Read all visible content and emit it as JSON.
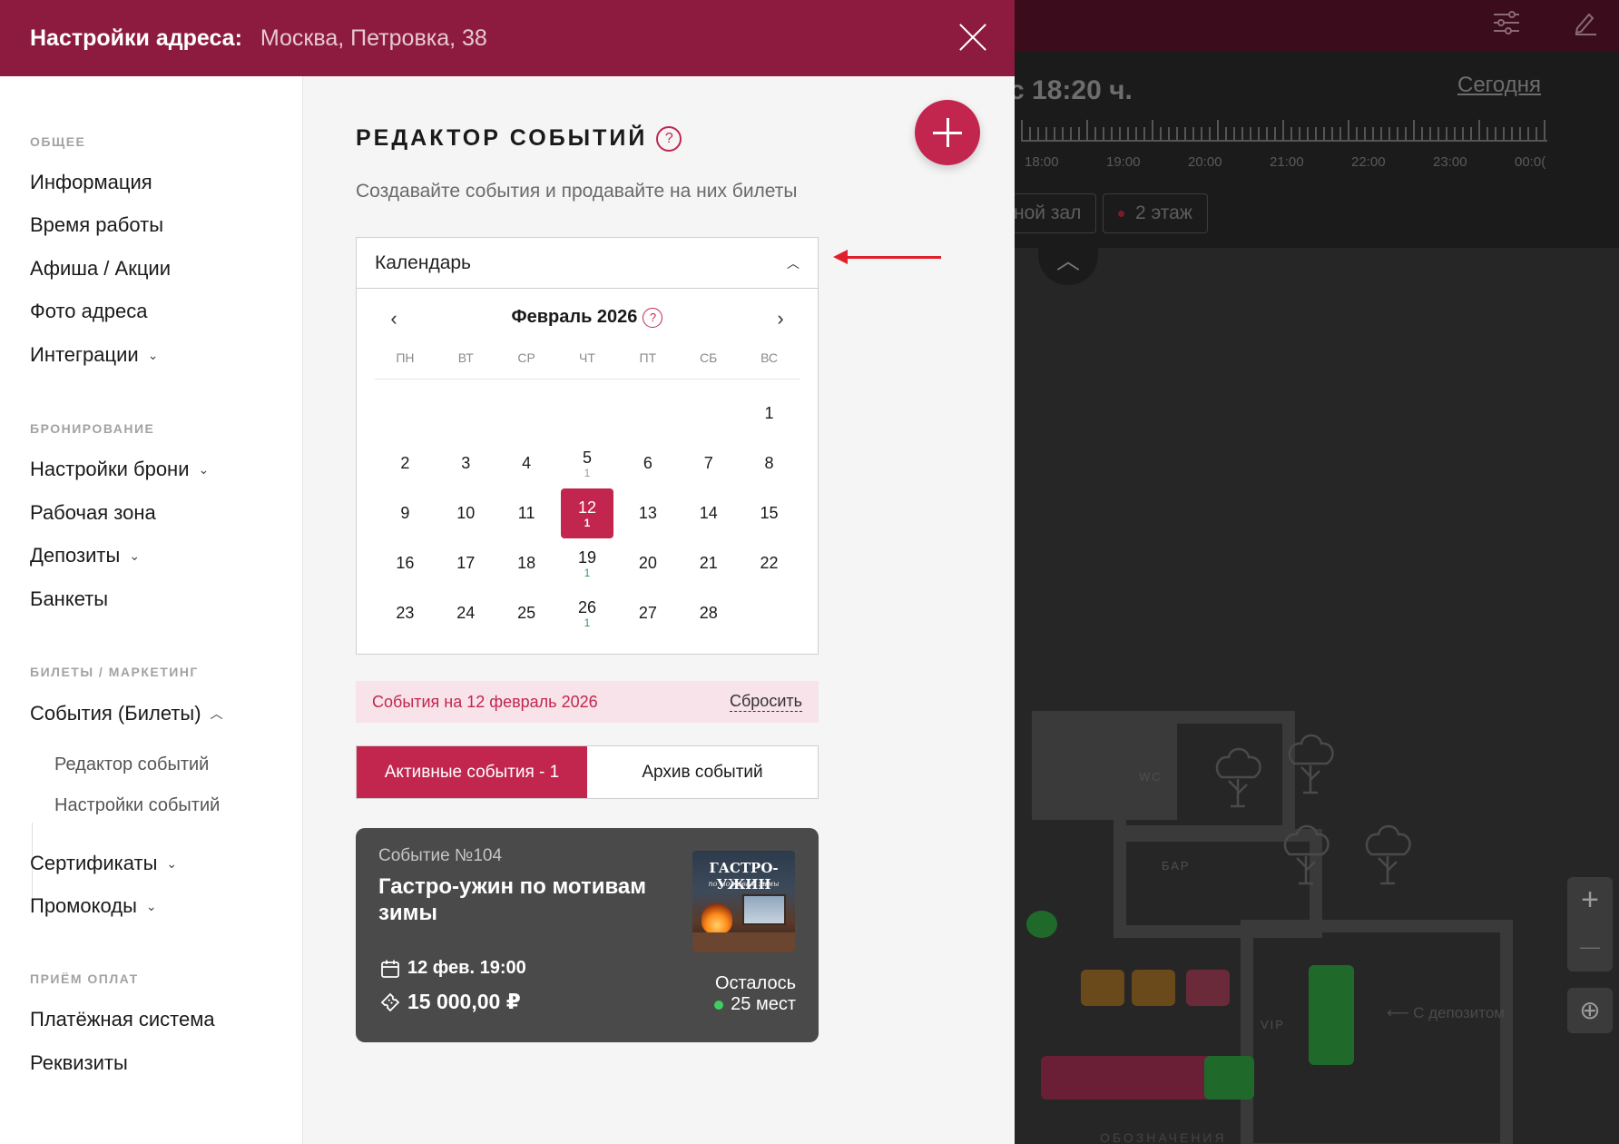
{
  "background": {
    "time_text": "с 18:20 ч.",
    "today_label": "Сегодня",
    "hours": [
      "18:00",
      "19:00",
      "20:00",
      "21:00",
      "22:00",
      "23:00",
      "00:0("
    ],
    "chips": [
      "ной зал",
      "2 этаж"
    ],
    "floor_labels": {
      "wc": "WC",
      "bar": "БАР",
      "vip": "VIP",
      "deposit_note": "С депозитом",
      "legend": "ОБОЗНАЧЕНИЯ"
    },
    "zoom_in": "+",
    "zoom_out": "—"
  },
  "header": {
    "title": "Настройки адреса:",
    "address": "Москва, Петровка, 38"
  },
  "sidebar": {
    "sections": [
      {
        "title": "ОБЩЕЕ",
        "items": [
          "Информация",
          "Время работы",
          "Афиша / Акции",
          "Фото адреса",
          "Интеграции"
        ]
      },
      {
        "title": "БРОНИРОВАНИЕ",
        "items": [
          "Настройки брони",
          "Рабочая зона",
          "Депозиты",
          "Банкеты"
        ]
      },
      {
        "title": "БИЛЕТЫ / МАРКЕТИНГ",
        "items": [
          "События (Билеты)",
          "Сертификаты",
          "Промокоды"
        ]
      },
      {
        "title": "ПРИЁМ ОПЛАТ",
        "items": [
          "Платёжная система",
          "Реквизиты"
        ]
      }
    ],
    "subitems": [
      "Редактор событий",
      "Настройки событий"
    ]
  },
  "main": {
    "title": "РЕДАКТОР СОБЫТИЙ",
    "subtitle": "Создавайте события и продавайте на них билеты",
    "calendar": {
      "dropdown_label": "Календарь",
      "month": "Февраль 2026",
      "weekdays": [
        "ПН",
        "ВТ",
        "СР",
        "ЧТ",
        "ПТ",
        "СБ",
        "ВС"
      ],
      "days": [
        {
          "d": ""
        },
        {
          "d": ""
        },
        {
          "d": ""
        },
        {
          "d": ""
        },
        {
          "d": ""
        },
        {
          "d": ""
        },
        {
          "d": "1"
        },
        {
          "d": "2"
        },
        {
          "d": "3"
        },
        {
          "d": "4"
        },
        {
          "d": "5",
          "c": "1"
        },
        {
          "d": "6"
        },
        {
          "d": "7"
        },
        {
          "d": "8"
        },
        {
          "d": "9"
        },
        {
          "d": "10"
        },
        {
          "d": "11"
        },
        {
          "d": "12",
          "c": "1",
          "sel": true
        },
        {
          "d": "13"
        },
        {
          "d": "14"
        },
        {
          "d": "15"
        },
        {
          "d": "16"
        },
        {
          "d": "17"
        },
        {
          "d": "18"
        },
        {
          "d": "19",
          "c": "1",
          "green": true
        },
        {
          "d": "20"
        },
        {
          "d": "21"
        },
        {
          "d": "22"
        },
        {
          "d": "23"
        },
        {
          "d": "24"
        },
        {
          "d": "25"
        },
        {
          "d": "26",
          "c": "1",
          "green": true
        },
        {
          "d": "27"
        },
        {
          "d": "28"
        },
        {
          "d": ""
        }
      ]
    },
    "filter": {
      "text": "События на 12 февраль 2026",
      "reset": "Сбросить"
    },
    "tabs": {
      "active": "Активные события - 1",
      "archive": "Архив событий"
    },
    "event": {
      "number": "Событие №104",
      "title": "Гастро-ужин по мотивам зимы",
      "image_title": "ГАСТРО-УЖИН",
      "image_subtitle": "по мотивам зимы",
      "date": "12 фев. 19:00",
      "price": "15 000,00 ₽",
      "left_label": "Осталось",
      "left_value": "25 мест"
    }
  },
  "colors": {
    "brand": "#8d1b3f",
    "accent": "#c2264f",
    "available": "#3fcf5e"
  }
}
